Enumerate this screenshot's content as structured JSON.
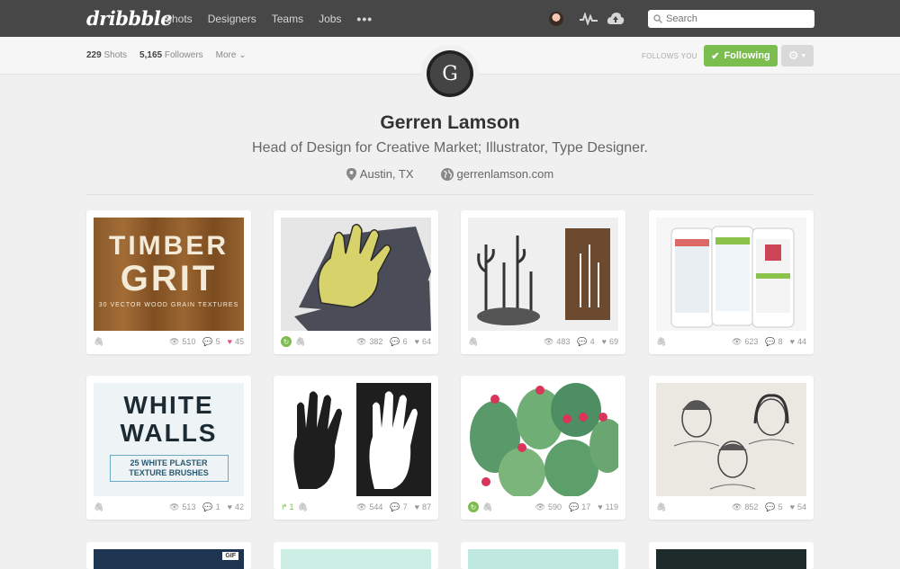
{
  "nav": {
    "logo": "dribbble",
    "links": [
      "Shots",
      "Designers",
      "Teams",
      "Jobs"
    ],
    "more_dots": "•••",
    "search_placeholder": "Search"
  },
  "subbar": {
    "shots_count": "229",
    "shots_label": "Shots",
    "followers_count": "5,165",
    "followers_label": "Followers",
    "more_label": "More",
    "follows_you": "FOLLOWS YOU",
    "following_label": "Following"
  },
  "profile": {
    "avatar_glyph": "G",
    "name": "Gerren Lamson",
    "bio": "Head of Design for Creative Market; Illustrator, Type Designer.",
    "location": "Austin, TX",
    "website": "gerrenlamson.com"
  },
  "shots": [
    {
      "views": "510",
      "comments": "5",
      "likes": "45",
      "liked": true,
      "rebound": false,
      "rebounds": ""
    },
    {
      "views": "382",
      "comments": "6",
      "likes": "64",
      "liked": false,
      "rebound": true,
      "rebounds": ""
    },
    {
      "views": "483",
      "comments": "4",
      "likes": "69",
      "liked": false,
      "rebound": false,
      "rebounds": ""
    },
    {
      "views": "623",
      "comments": "8",
      "likes": "44",
      "liked": false,
      "rebound": false,
      "rebounds": ""
    },
    {
      "views": "513",
      "comments": "1",
      "likes": "42",
      "liked": false,
      "rebound": false,
      "rebounds": ""
    },
    {
      "views": "544",
      "comments": "7",
      "likes": "87",
      "liked": false,
      "rebound": false,
      "rebounds": "1"
    },
    {
      "views": "590",
      "comments": "17",
      "likes": "119",
      "liked": false,
      "rebound": true,
      "rebounds": ""
    },
    {
      "views": "852",
      "comments": "5",
      "likes": "54",
      "liked": false,
      "rebound": false,
      "rebounds": ""
    }
  ],
  "thumbs": {
    "timber": {
      "l1": "TIMBER",
      "l2": "GRIT",
      "l3": "30 VECTOR WOOD GRAIN TEXTURES"
    },
    "white": {
      "w1": "WHITE",
      "w2": "WALLS",
      "w3a": "25 WHITE PLASTER",
      "w3b": "TEXTURE BRUSHES"
    },
    "gif_badge": "GIF",
    "colors": {
      "accent_green": "#7bbd4f",
      "like_pink": "#ea4c89",
      "nav_bg": "#474747"
    }
  }
}
